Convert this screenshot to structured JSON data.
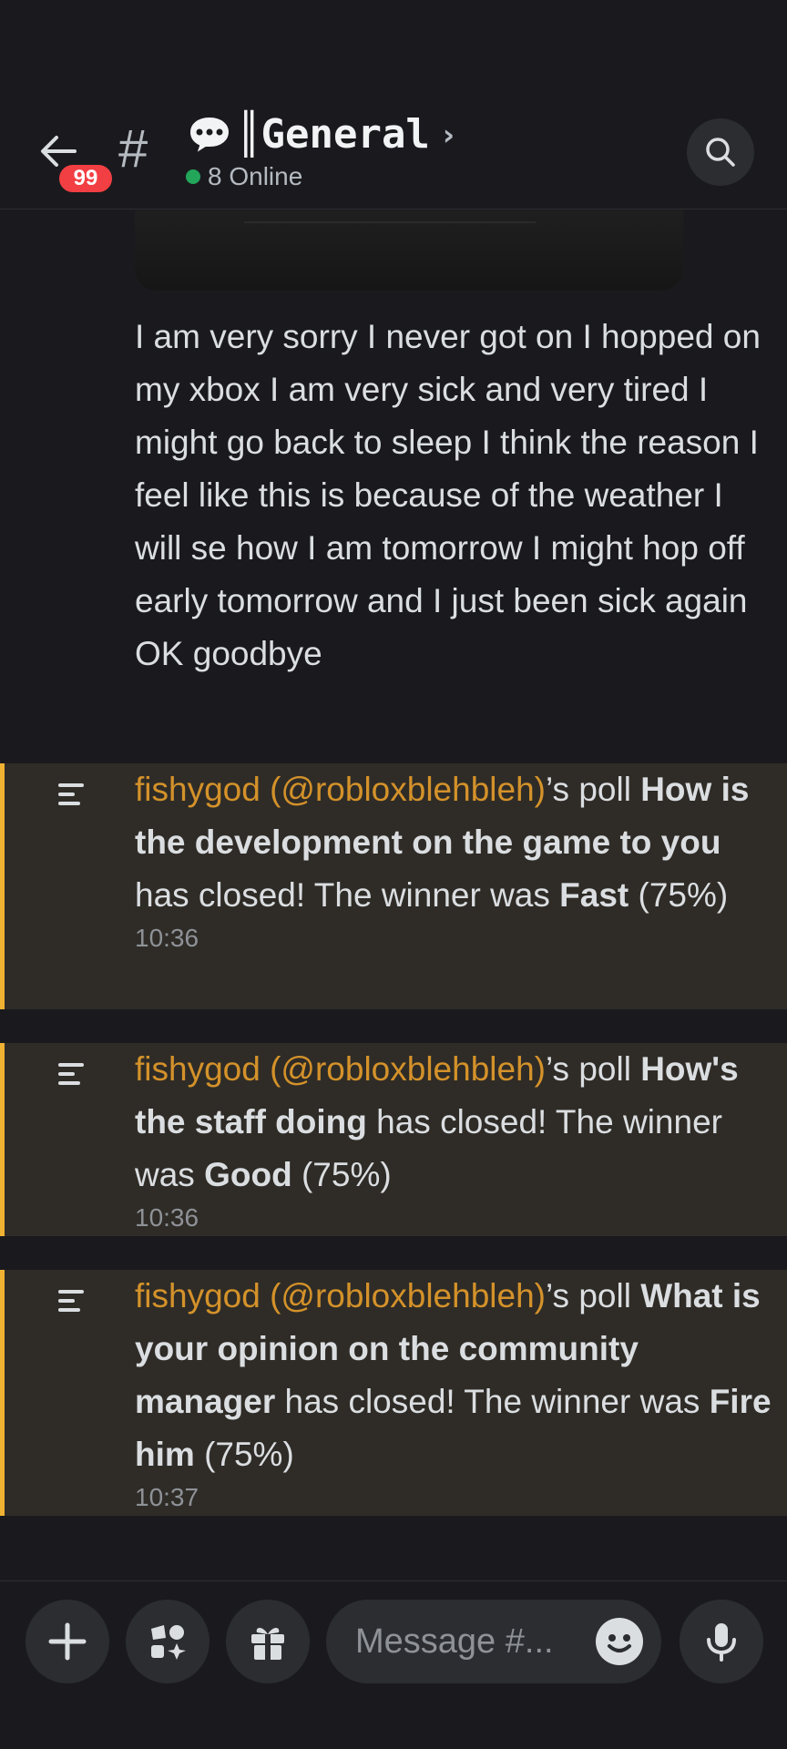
{
  "header": {
    "badge_count": "99",
    "channel_name": "║General",
    "online_text": "8 Online"
  },
  "message": {
    "text": "I am very sorry I never got on I hopped on my xbox  I am very sick and very tired I might go back to sleep I think the reason I feel like this is because of the weather I will se how I am tomorrow I might hop off early tomorrow and I just been sick again OK goodbye"
  },
  "polls": [
    {
      "author": "fishygod (@robloxblehbleh)",
      "suffix": "’s poll",
      "question": "How is the development on the game to you",
      "closed_text": "has closed! The winner was",
      "winner": "Fast",
      "percent": "(75%)",
      "time": "10:36"
    },
    {
      "author": "fishygod (@robloxblehbleh)",
      "suffix": "’s poll",
      "question": "How's the staff doing",
      "closed_text": "has closed! The winner was",
      "winner": "Good",
      "percent": "(75%)",
      "time": "10:36"
    },
    {
      "author": "fishygod (@robloxblehbleh)",
      "suffix": "’s poll",
      "question": "What is your opinion on the community manager",
      "closed_text": "has closed! The winner was",
      "winner": "Fire him",
      "percent": "(75%)",
      "time": "10:37"
    }
  ],
  "composer": {
    "placeholder": "Message #..."
  },
  "colors": {
    "background": "#1a1a1e",
    "poll_highlight": "#2f2c27",
    "poll_accent": "#f0b232",
    "author": "#d4922a",
    "badge": "#f23f43",
    "online": "#23a55a"
  },
  "icons": [
    "back-arrow-icon",
    "hash-icon",
    "speech-bubble-icon",
    "chevron-right-icon",
    "search-icon",
    "poll-icon",
    "plus-icon",
    "apps-icon",
    "gift-icon",
    "emoji-icon",
    "microphone-icon"
  ]
}
